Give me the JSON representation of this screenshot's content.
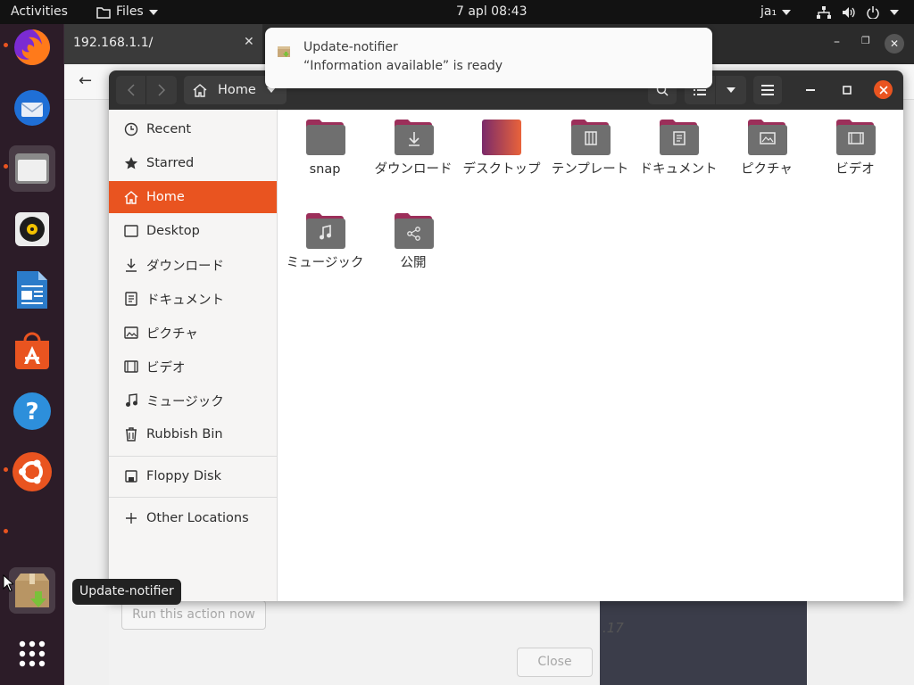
{
  "topbar": {
    "activities": "Activities",
    "app_menu": "Files",
    "clock": "7 apl  08:43",
    "input_method": "ja₁"
  },
  "browser": {
    "tab_title": "192.168.1.1/"
  },
  "background_dialog": {
    "run_action_button": "Run this action now",
    "close_button": "Close",
    "partial_text": ".17"
  },
  "notification": {
    "title": "Update-notifier",
    "body": "“Information available” is ready"
  },
  "tooltip": {
    "text": "Update-notifier"
  },
  "files": {
    "path_label": "Home",
    "sidebar": {
      "recent": "Recent",
      "starred": "Starred",
      "home": "Home",
      "desktop": "Desktop",
      "downloads": "ダウンロード",
      "documents": "ドキュメント",
      "pictures": "ピクチャ",
      "videos": "ビデオ",
      "music": "ミュージック",
      "trash": "Rubbish Bin",
      "floppy": "Floppy Disk",
      "other_locations": "Other Locations"
    },
    "items": {
      "snap": "snap",
      "downloads": "ダウンロード",
      "desktop": "デスクトップ",
      "templates": "テンプレート",
      "documents": "ドキュメント",
      "pictures": "ピクチャ",
      "videos": "ビデオ",
      "music": "ミュージック",
      "public": "公開"
    }
  },
  "colors": {
    "accent": "#e95420",
    "folder_tab": "#9c2f5a",
    "folder_body": "#6f6f6f",
    "headerbar": "#303030"
  },
  "icons": [
    "firefox-icon",
    "thunderbird-icon",
    "files-icon",
    "rhythmbox-icon",
    "libreoffice-writer-icon",
    "software-icon",
    "help-icon",
    "ubuntu-icon",
    "update-notifier-icon",
    "app-grid-icon"
  ]
}
